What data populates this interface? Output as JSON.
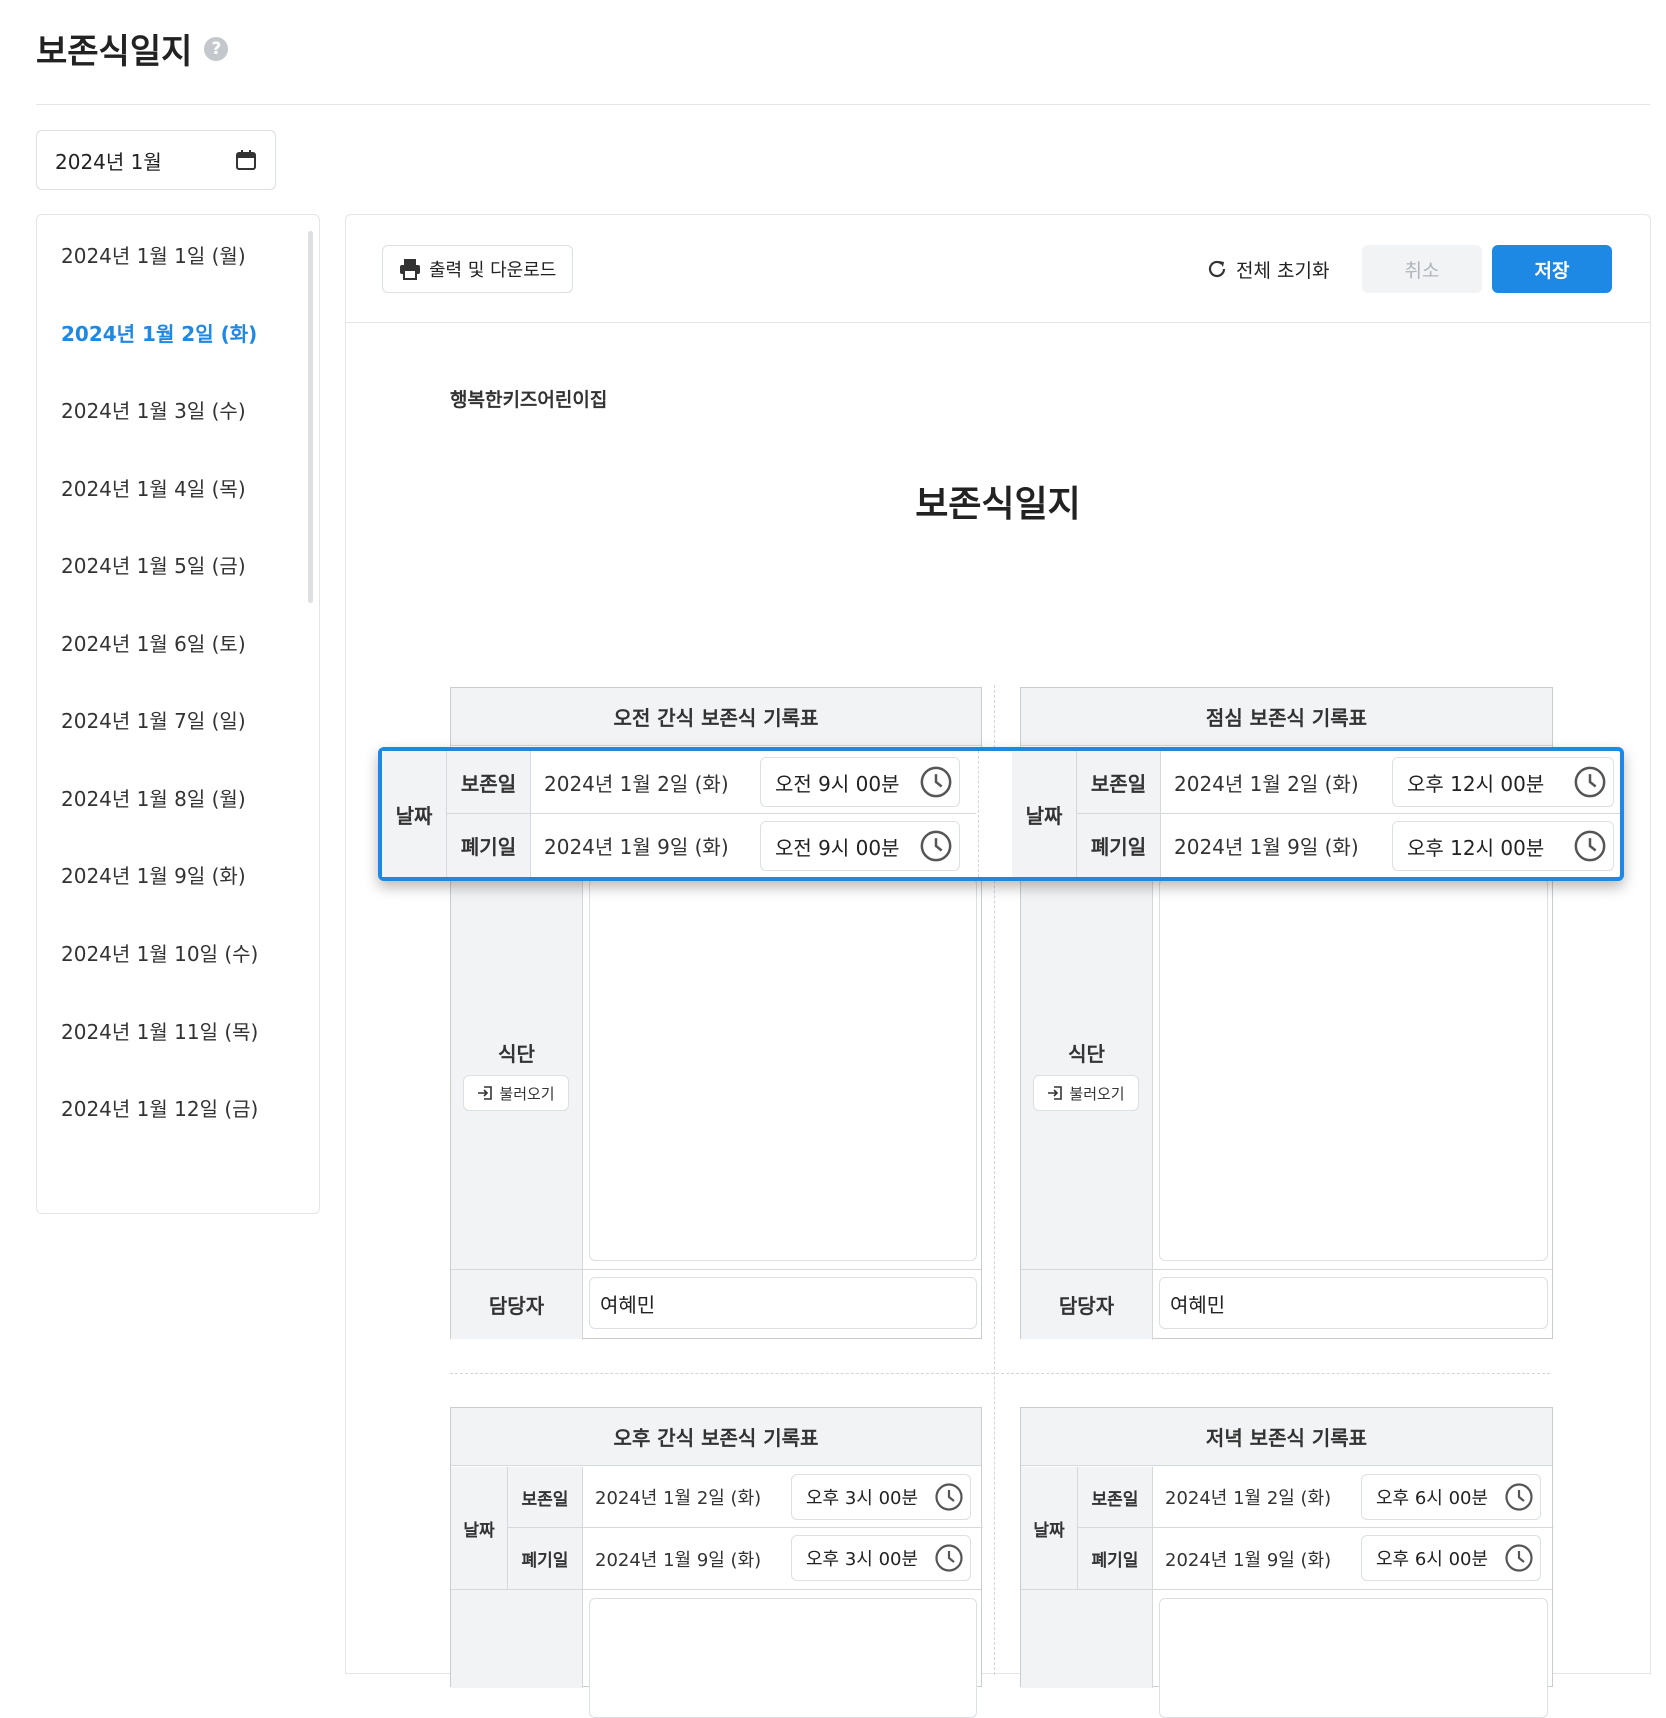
{
  "page": {
    "title": "보존식일지",
    "help_icon": "?"
  },
  "month_picker": {
    "value": "2024년 1월",
    "icon": "calendar-icon"
  },
  "date_list": {
    "active_index": 1,
    "items": [
      "2024년 1월 1일 (월)",
      "2024년 1월 2일 (화)",
      "2024년 1월 3일 (수)",
      "2024년 1월 4일 (목)",
      "2024년 1월 5일 (금)",
      "2024년 1월 6일 (토)",
      "2024년 1월 7일 (일)",
      "2024년 1월 8일 (월)",
      "2024년 1월 9일 (화)",
      "2024년 1월 10일 (수)",
      "2024년 1월 11일 (목)",
      "2024년 1월 12일 (금)"
    ]
  },
  "toolbar": {
    "print_label": "출력 및 다운로드",
    "reset_label": "전체 초기화",
    "cancel_label": "취소",
    "save_label": "저장"
  },
  "document": {
    "org_name": "행복한키즈어린이집",
    "title": "보존식일지"
  },
  "labels": {
    "date": "날짜",
    "keep_date": "보존일",
    "discard_date": "폐기일",
    "menu": "식단",
    "load": "불러오기",
    "manager": "담당자"
  },
  "cards": [
    {
      "title": "오전 간식 보존식 기록표",
      "keep_date": "2024년 1월 2일 (화)",
      "keep_time": "오전 9시 00분",
      "discard_date": "2024년 1월 9일 (화)",
      "discard_time": "오전 9시 00분",
      "manager": "여혜민"
    },
    {
      "title": "점심 보존식 기록표",
      "keep_date": "2024년 1월 2일 (화)",
      "keep_time": "오후 12시 00분",
      "discard_date": "2024년 1월 9일 (화)",
      "discard_time": "오후 12시 00분",
      "manager": "여혜민"
    },
    {
      "title": "오후 간식 보존식 기록표",
      "keep_date": "2024년 1월 2일 (화)",
      "keep_time": "오후 3시 00분",
      "discard_date": "2024년 1월 9일 (화)",
      "discard_time": "오후 3시 00분"
    },
    {
      "title": "저녁 보존식 기록표",
      "keep_date": "2024년 1월 2일 (화)",
      "keep_time": "오후 6시 00분",
      "discard_date": "2024년 1월 9일 (화)",
      "discard_time": "오후 6시 00분"
    }
  ],
  "colors": {
    "accent": "#1e88e5",
    "header_bg": "#f2f3f5",
    "border": "#c9cdd2"
  }
}
